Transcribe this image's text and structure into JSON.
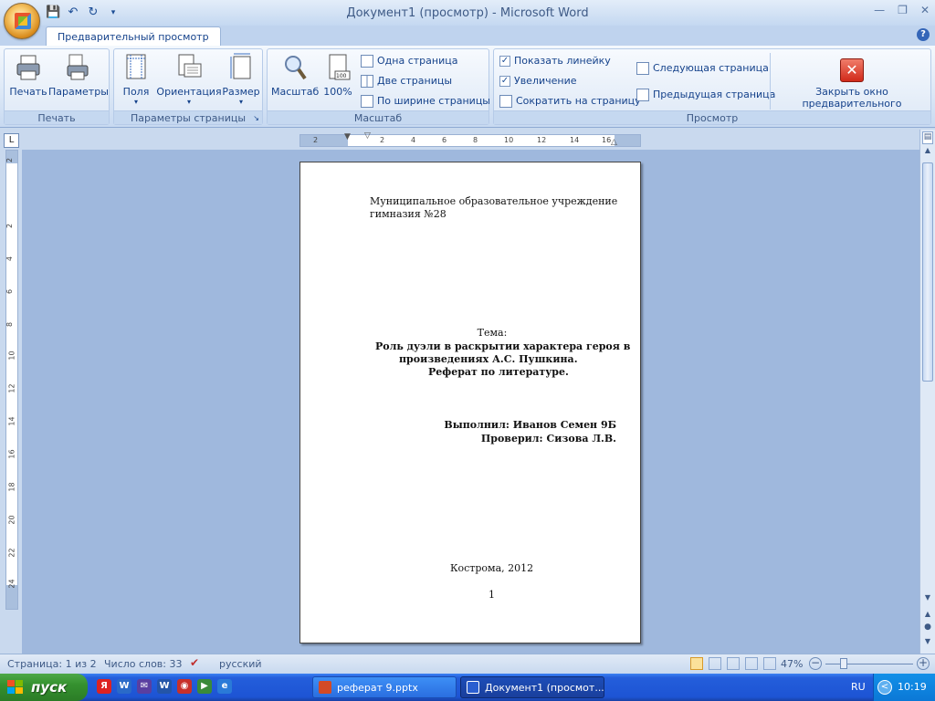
{
  "window": {
    "title": "Документ1 (просмотр) - Microsoft Word"
  },
  "ribbon": {
    "tab": "Предварительный просмотр",
    "groups": {
      "print": {
        "label": "Печать",
        "print_btn": "Печать",
        "params_btn": "Параметры"
      },
      "page_setup": {
        "label": "Параметры страницы",
        "margins_btn": "Поля",
        "orientation_btn": "Ориентация",
        "size_btn": "Размер"
      },
      "zoom": {
        "label": "Масштаб",
        "zoom_btn": "Масштаб",
        "hundred_btn": "100%",
        "one_page": "Одна страница",
        "two_pages": "Две страницы",
        "page_width": "По ширине страницы"
      },
      "preview": {
        "label": "Просмотр",
        "show_ruler": "Показать линейку",
        "show_ruler_checked": true,
        "magnifier": "Увеличение",
        "magnifier_checked": true,
        "shrink": "Сократить на страницу",
        "next_page": "Следующая страница",
        "prev_page": "Предыдущая страница",
        "close_line1": "Закрыть окно",
        "close_line2": "предварительного просмотра"
      }
    }
  },
  "hruler_ticks": [
    "2",
    "2",
    "4",
    "6",
    "8",
    "10",
    "12",
    "14",
    "16"
  ],
  "vruler_ticks": [
    "2",
    "2",
    "4",
    "6",
    "8",
    "10",
    "12",
    "14",
    "16",
    "18",
    "20",
    "22",
    "24"
  ],
  "document": {
    "org_line1": "Муниципальное образовательное учреждение",
    "org_line2": "гимназия №28",
    "topic_label": "Тема:",
    "topic_line1": "Роль дуэли в раскрытии характера героя в",
    "topic_line2": "произведениях А.С. Пушкина.",
    "topic_line3": "Реферат по литературе.",
    "author": "Выполнил: Иванов Семен 9Б",
    "checker": "Проверил: Сизова Л.В.",
    "city_year": "Кострома, 2012",
    "page_number": "1"
  },
  "status": {
    "page": "Страница: 1 из 2",
    "words": "Число слов: 33",
    "language": "русский",
    "zoom": "47%",
    "zoom_value": 47
  },
  "taskbar": {
    "start": "пуск",
    "tasks": [
      "реферат 9.pptx",
      "Документ1 (просмот..."
    ],
    "lang": "RU",
    "time": "10:19"
  }
}
